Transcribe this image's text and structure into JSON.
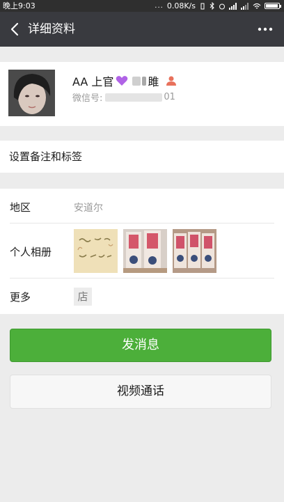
{
  "status_bar": {
    "time": "晚上9:03",
    "dots": "...",
    "net_speed": "0.08K/s"
  },
  "nav": {
    "title": "详细资料",
    "back_icon": "chevron-left-icon",
    "more_icon": "more-dots-icon"
  },
  "profile": {
    "name": "AA 上官",
    "name_suffix_visible": "雎",
    "wechat_id_label": "微信号:",
    "wechat_id_suffix": "01",
    "icons": [
      "purple-heart-icon",
      "person-icon"
    ]
  },
  "remark": {
    "label": "设置备注和标签"
  },
  "info": {
    "region_label": "地区",
    "region_value": "安道尔",
    "album_label": "个人相册",
    "more_label": "更多",
    "store_icon_char": "店"
  },
  "actions": {
    "send_message": "发消息",
    "video_call": "视频通话"
  },
  "colors": {
    "nav_bg": "#393a3f",
    "primary_green": "#4caf3a",
    "page_bg": "#ececec"
  }
}
